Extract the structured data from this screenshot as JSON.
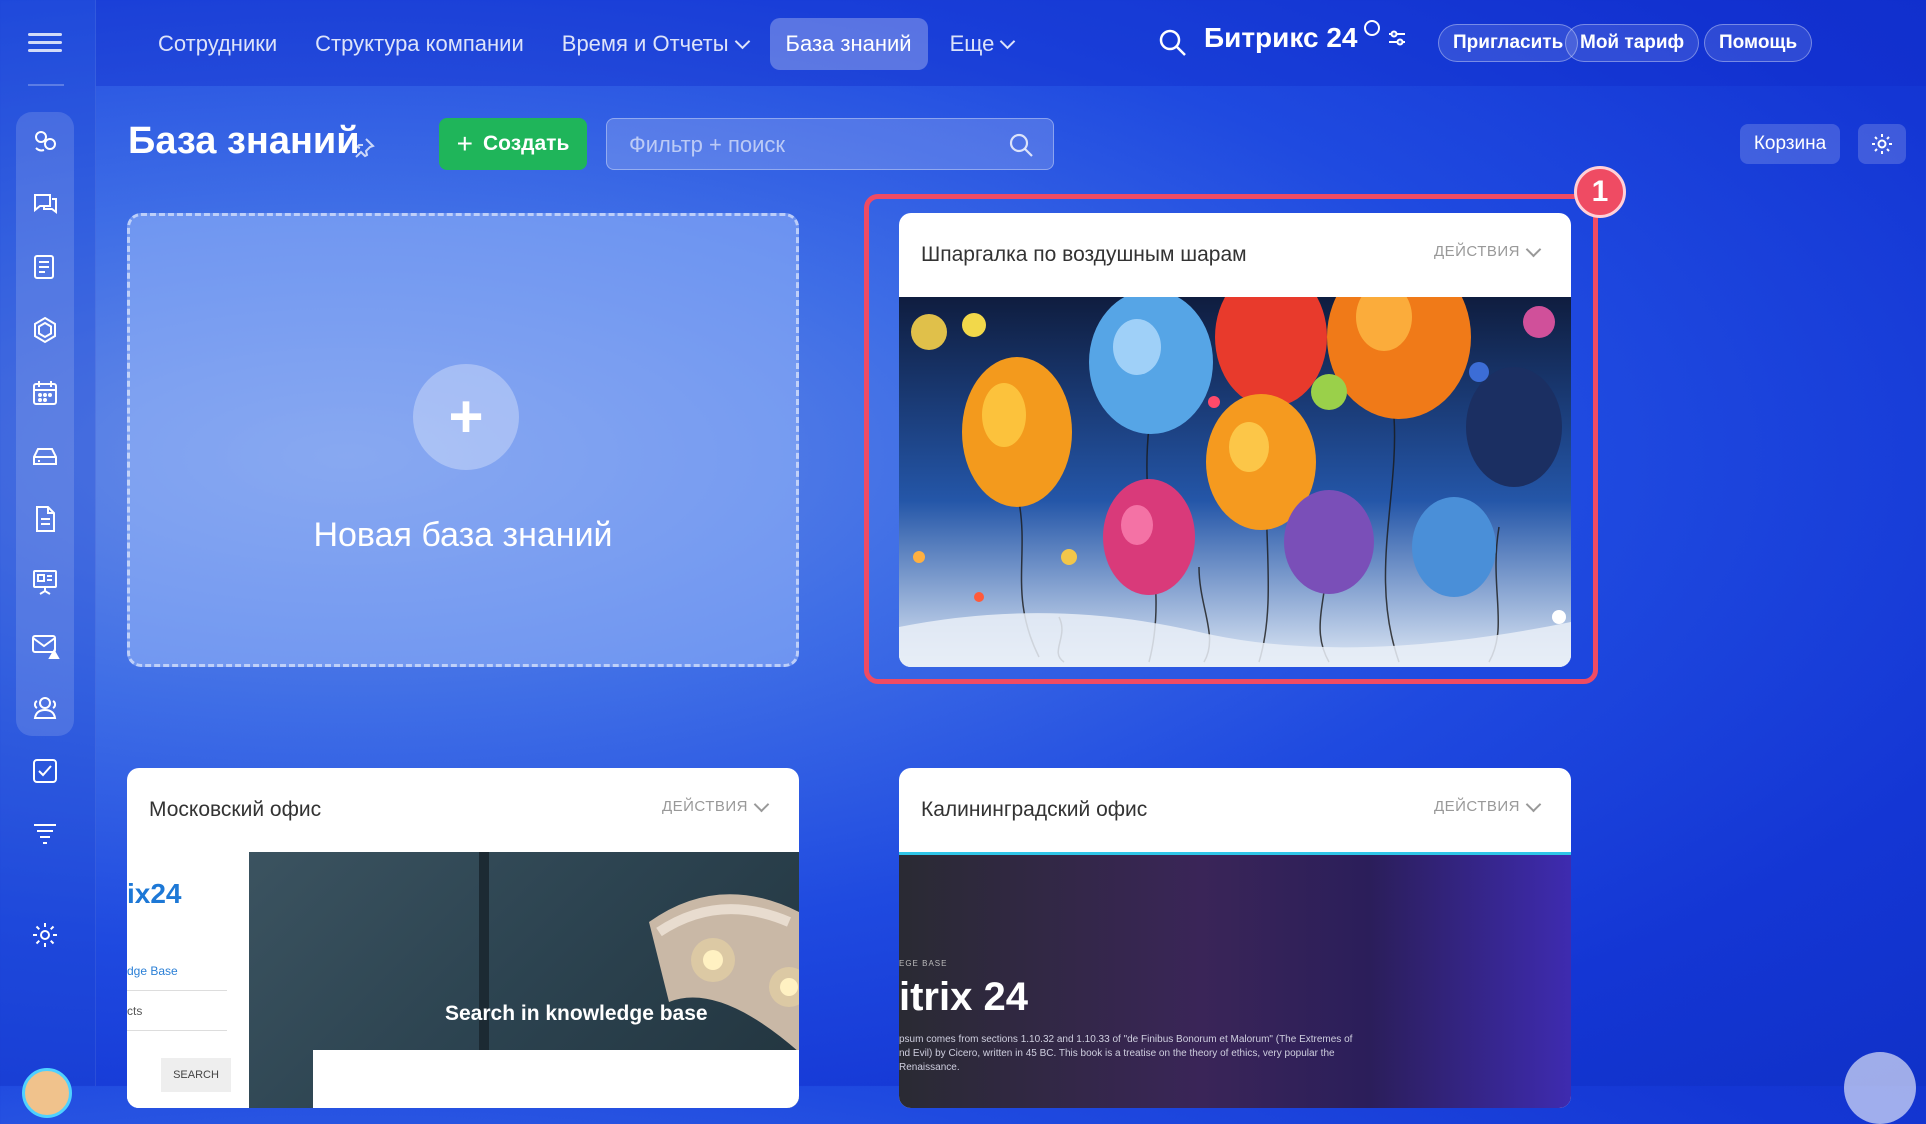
{
  "nav": {
    "items": [
      {
        "label": "Сотрудники",
        "dropdown": false,
        "active": false
      },
      {
        "label": "Структура компании",
        "dropdown": false,
        "active": false
      },
      {
        "label": "Время и Отчеты",
        "dropdown": true,
        "active": false
      },
      {
        "label": "База знаний",
        "dropdown": false,
        "active": true
      },
      {
        "label": "Еще",
        "dropdown": true,
        "active": false
      }
    ]
  },
  "brand": {
    "name": "Битрикс 24"
  },
  "top_buttons": {
    "invite": "Пригласить",
    "tariff": "Мой тариф",
    "help": "Помощь"
  },
  "page": {
    "title": "База знаний",
    "create_label": "Создать",
    "filter_placeholder": "Фильтр + поиск",
    "cart_label": "Корзина"
  },
  "new_kb": {
    "label": "Новая база знаний"
  },
  "cards": [
    {
      "title": "Шпаргалка по воздушным шарам",
      "actions": "ДЕЙСТВИЯ"
    },
    {
      "title": "Московский офис",
      "actions": "ДЕЙСТВИЯ",
      "logo": "ix24",
      "link": "dge Base",
      "side_text": "cts",
      "search_button": "SEARCH",
      "hero": "Search in knowledge base"
    },
    {
      "title": "Калининградский офис",
      "actions": "ДЕЙСТВИЯ",
      "small": "EGE BASE",
      "big": "itrix 24",
      "text": "psum comes from sections 1.10.32 and 1.10.33 of \"de Finibus Bonorum et Malorum\" (The Extremes of nd Evil) by Cicero, written in 45 BC. This book is a treatise on the theory of ethics, very popular the Renaissance."
    }
  ],
  "highlight": {
    "badge": "1",
    "color": "#ef4b63"
  },
  "colors": {
    "accent_green": "#1fb55a",
    "highlight_red": "#ef4b63"
  }
}
